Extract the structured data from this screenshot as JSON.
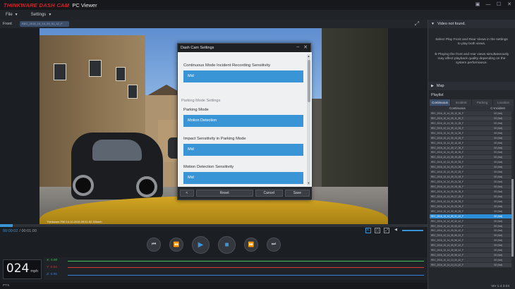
{
  "app": {
    "brand": "THINKWARE DASH CAM",
    "title": "PC Viewer",
    "window_controls": [
      "▣",
      "—",
      "☐",
      "✕"
    ]
  },
  "menu": {
    "items": [
      {
        "label": "File"
      },
      {
        "label": "Settings"
      }
    ]
  },
  "video": {
    "view_label": "Front",
    "file_name": "REC_2016_10_14_09_51_42_F",
    "overlay": "Thinkware  F50  14.10.2016  09:51:52  30km/h"
  },
  "dialog": {
    "title": "Dash Cam Settings",
    "section": "Parking Mode Settings",
    "settings": [
      {
        "label": "Continuous Mode Incident Recording Sensitivity",
        "value": "Mid"
      },
      {
        "label": "Parking Mode",
        "value": "Motion Detection"
      },
      {
        "label": "Impact Sensitivity in Parking Mode",
        "value": "Mid"
      },
      {
        "label": "Motion Detection Sensitivity",
        "value": "Mid"
      }
    ],
    "buttons": {
      "back": "<",
      "reset": "Reset",
      "cancel": "Cancel",
      "save": "Save"
    }
  },
  "right_panel": {
    "rear_header": "Video not found.",
    "rear_text_1": "Select Play Front and Rear Views in the settings to play both views.",
    "rear_text_2": "※ Playing the front and rear views simultaneously may affect playback quality depending on the system performance.",
    "map_header": "Map",
    "playlist_header": "Playlist",
    "tabs": [
      {
        "label": "Continuous"
      },
      {
        "label": "Incident"
      },
      {
        "label": "Parking"
      },
      {
        "label": "Location"
      }
    ],
    "columns": {
      "file": "Continuous",
      "type": "C-Incident"
    },
    "rows": [
      {
        "name": "REC_2016_10_14_09_10_35_F",
        "value": "0G (Not)"
      },
      {
        "name": "REC_2016_10_14_09_11_35_F",
        "value": "0G (Not)"
      },
      {
        "name": "REC_2016_10_14_09_12_35_F",
        "value": "0G (Not)"
      },
      {
        "name": "REC_2016_10_14_09_13_35_F",
        "value": "0G (Not)"
      },
      {
        "name": "REC_2016_10_14_09_14_35_F",
        "value": "0G (Not)"
      },
      {
        "name": "REC_2016_10_14_09_15_35_F",
        "value": "0G (Not)"
      },
      {
        "name": "REC_2016_10_14_09_16_35_F",
        "value": "0G (Not)"
      },
      {
        "name": "REC_2016_10_14_09_17_35_F",
        "value": "0G (Not)"
      },
      {
        "name": "REC_2016_10_14_09_18_35_F",
        "value": "0G (Not)"
      },
      {
        "name": "REC_2016_10_14_09_19_35_F",
        "value": "0G (Not)"
      },
      {
        "name": "REC_2016_10_14_09_20_35_F",
        "value": "0G (Not)"
      },
      {
        "name": "REC_2016_10_14_09_21_35_F",
        "value": "0G (Not)"
      },
      {
        "name": "REC_2016_10_14_09_22_35_F",
        "value": "0G (Not)"
      },
      {
        "name": "REC_2016_10_14_09_23_35_F",
        "value": "0G (Not)"
      },
      {
        "name": "REC_2016_10_14_09_24_35_F",
        "value": "0G (Not)"
      },
      {
        "name": "REC_2016_10_14_09_25_35_F",
        "value": "0G (Not)"
      },
      {
        "name": "REC_2016_10_14_09_26_35_F",
        "value": "0G (Not)"
      },
      {
        "name": "REC_2016_10_14_09_27_35_F",
        "value": "0G (Not)"
      },
      {
        "name": "REC_2016_10_14_09_28_35_F",
        "value": "0G (Not)"
      },
      {
        "name": "REC_2016_10_14_09_29_35_F",
        "value": "0G (Not)"
      },
      {
        "name": "REC_2016_10_14_09_30_35_F",
        "value": "0G (Not)"
      },
      {
        "name": "REC_2016_10_14_09_51_42_F",
        "value": "0G (Not)",
        "selected": true
      },
      {
        "name": "REC_2016_10_14_09_52_42_F",
        "value": "0G (Not)"
      },
      {
        "name": "REC_2016_10_14_09_53_42_F",
        "value": "0G (Not)"
      },
      {
        "name": "REC_2016_10_14_09_54_42_F",
        "value": "0G (Not)"
      },
      {
        "name": "REC_2016_10_14_09_55_42_F",
        "value": "0G (Not)"
      },
      {
        "name": "REC_2016_10_14_09_56_42_F",
        "value": "0G (Not)"
      },
      {
        "name": "REC_2016_10_14_09_57_42_F",
        "value": "0G (Not)"
      },
      {
        "name": "REC_2016_10_14_09_58_42_F",
        "value": "0G (Not)"
      },
      {
        "name": "REC_2016_10_14_09_59_42_F",
        "value": "0G (Not)"
      },
      {
        "name": "REC_2016_10_14_10_00_42_F",
        "value": "0G (Not)"
      },
      {
        "name": "REC_2016_10_14_10_01_42_F",
        "value": "0G (Not)"
      }
    ],
    "version": "Ver 1.4.3.04"
  },
  "playback": {
    "current_time": "00:00:02",
    "total_time": "/ 00:01:00",
    "progress": 0.03,
    "speed": "024",
    "speed_unit": "mph",
    "gsensor": [
      {
        "axis": "X",
        "label": "X: 0.00",
        "color": "#3ec35a"
      },
      {
        "axis": "Y",
        "label": "Y: 0.04",
        "color": "#d83a3a"
      },
      {
        "axis": "Z",
        "label": "Z: 0.05",
        "color": "#3a7fe0"
      }
    ],
    "status": "PTS"
  },
  "colors": {
    "accent": "#3a95d6",
    "brand_red": "#d8222a"
  }
}
